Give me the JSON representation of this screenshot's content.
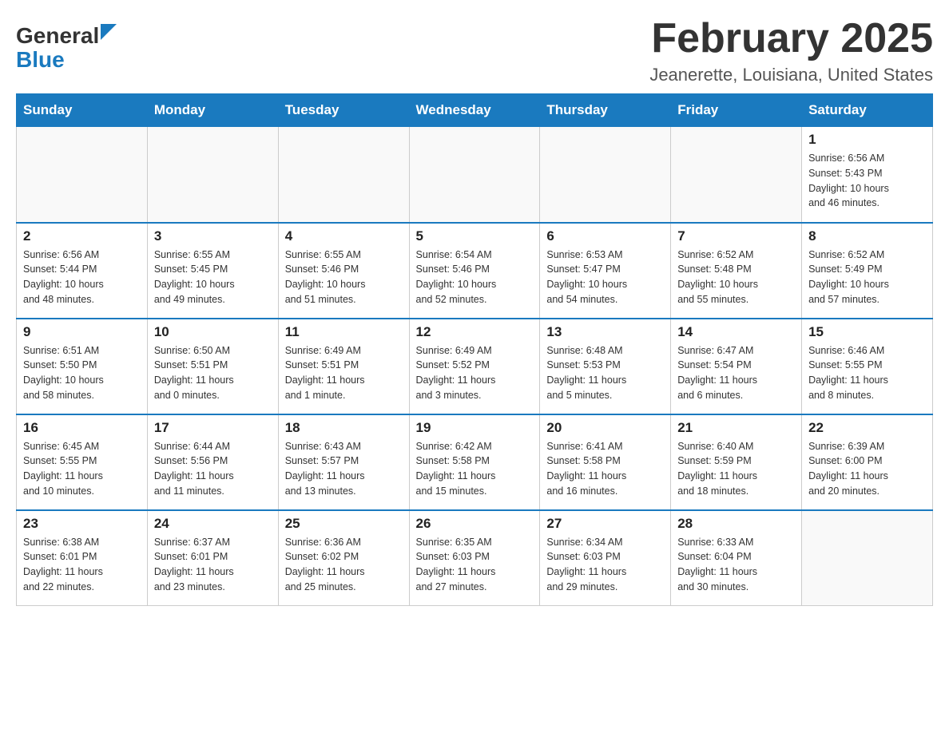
{
  "header": {
    "logo_general": "General",
    "logo_blue": "Blue",
    "month_title": "February 2025",
    "location": "Jeanerette, Louisiana, United States"
  },
  "days_of_week": [
    "Sunday",
    "Monday",
    "Tuesday",
    "Wednesday",
    "Thursday",
    "Friday",
    "Saturday"
  ],
  "weeks": [
    [
      {
        "day": "",
        "info": ""
      },
      {
        "day": "",
        "info": ""
      },
      {
        "day": "",
        "info": ""
      },
      {
        "day": "",
        "info": ""
      },
      {
        "day": "",
        "info": ""
      },
      {
        "day": "",
        "info": ""
      },
      {
        "day": "1",
        "info": "Sunrise: 6:56 AM\nSunset: 5:43 PM\nDaylight: 10 hours\nand 46 minutes."
      }
    ],
    [
      {
        "day": "2",
        "info": "Sunrise: 6:56 AM\nSunset: 5:44 PM\nDaylight: 10 hours\nand 48 minutes."
      },
      {
        "day": "3",
        "info": "Sunrise: 6:55 AM\nSunset: 5:45 PM\nDaylight: 10 hours\nand 49 minutes."
      },
      {
        "day": "4",
        "info": "Sunrise: 6:55 AM\nSunset: 5:46 PM\nDaylight: 10 hours\nand 51 minutes."
      },
      {
        "day": "5",
        "info": "Sunrise: 6:54 AM\nSunset: 5:46 PM\nDaylight: 10 hours\nand 52 minutes."
      },
      {
        "day": "6",
        "info": "Sunrise: 6:53 AM\nSunset: 5:47 PM\nDaylight: 10 hours\nand 54 minutes."
      },
      {
        "day": "7",
        "info": "Sunrise: 6:52 AM\nSunset: 5:48 PM\nDaylight: 10 hours\nand 55 minutes."
      },
      {
        "day": "8",
        "info": "Sunrise: 6:52 AM\nSunset: 5:49 PM\nDaylight: 10 hours\nand 57 minutes."
      }
    ],
    [
      {
        "day": "9",
        "info": "Sunrise: 6:51 AM\nSunset: 5:50 PM\nDaylight: 10 hours\nand 58 minutes."
      },
      {
        "day": "10",
        "info": "Sunrise: 6:50 AM\nSunset: 5:51 PM\nDaylight: 11 hours\nand 0 minutes."
      },
      {
        "day": "11",
        "info": "Sunrise: 6:49 AM\nSunset: 5:51 PM\nDaylight: 11 hours\nand 1 minute."
      },
      {
        "day": "12",
        "info": "Sunrise: 6:49 AM\nSunset: 5:52 PM\nDaylight: 11 hours\nand 3 minutes."
      },
      {
        "day": "13",
        "info": "Sunrise: 6:48 AM\nSunset: 5:53 PM\nDaylight: 11 hours\nand 5 minutes."
      },
      {
        "day": "14",
        "info": "Sunrise: 6:47 AM\nSunset: 5:54 PM\nDaylight: 11 hours\nand 6 minutes."
      },
      {
        "day": "15",
        "info": "Sunrise: 6:46 AM\nSunset: 5:55 PM\nDaylight: 11 hours\nand 8 minutes."
      }
    ],
    [
      {
        "day": "16",
        "info": "Sunrise: 6:45 AM\nSunset: 5:55 PM\nDaylight: 11 hours\nand 10 minutes."
      },
      {
        "day": "17",
        "info": "Sunrise: 6:44 AM\nSunset: 5:56 PM\nDaylight: 11 hours\nand 11 minutes."
      },
      {
        "day": "18",
        "info": "Sunrise: 6:43 AM\nSunset: 5:57 PM\nDaylight: 11 hours\nand 13 minutes."
      },
      {
        "day": "19",
        "info": "Sunrise: 6:42 AM\nSunset: 5:58 PM\nDaylight: 11 hours\nand 15 minutes."
      },
      {
        "day": "20",
        "info": "Sunrise: 6:41 AM\nSunset: 5:58 PM\nDaylight: 11 hours\nand 16 minutes."
      },
      {
        "day": "21",
        "info": "Sunrise: 6:40 AM\nSunset: 5:59 PM\nDaylight: 11 hours\nand 18 minutes."
      },
      {
        "day": "22",
        "info": "Sunrise: 6:39 AM\nSunset: 6:00 PM\nDaylight: 11 hours\nand 20 minutes."
      }
    ],
    [
      {
        "day": "23",
        "info": "Sunrise: 6:38 AM\nSunset: 6:01 PM\nDaylight: 11 hours\nand 22 minutes."
      },
      {
        "day": "24",
        "info": "Sunrise: 6:37 AM\nSunset: 6:01 PM\nDaylight: 11 hours\nand 23 minutes."
      },
      {
        "day": "25",
        "info": "Sunrise: 6:36 AM\nSunset: 6:02 PM\nDaylight: 11 hours\nand 25 minutes."
      },
      {
        "day": "26",
        "info": "Sunrise: 6:35 AM\nSunset: 6:03 PM\nDaylight: 11 hours\nand 27 minutes."
      },
      {
        "day": "27",
        "info": "Sunrise: 6:34 AM\nSunset: 6:03 PM\nDaylight: 11 hours\nand 29 minutes."
      },
      {
        "day": "28",
        "info": "Sunrise: 6:33 AM\nSunset: 6:04 PM\nDaylight: 11 hours\nand 30 minutes."
      },
      {
        "day": "",
        "info": ""
      }
    ]
  ]
}
